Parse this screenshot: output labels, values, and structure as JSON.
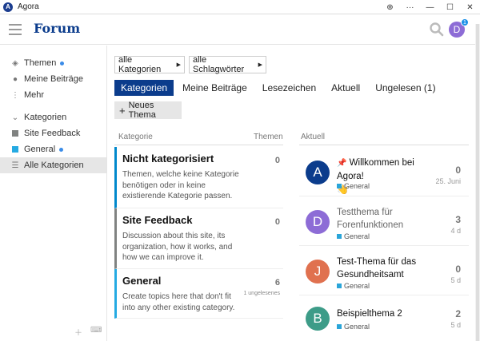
{
  "window": {
    "title": "Agora",
    "logo_letter": "A",
    "buttons": [
      "⊕",
      "···",
      "—",
      "☐",
      "✕"
    ]
  },
  "header": {
    "brand": "Forum",
    "user_initial": "D",
    "notification_count": "1",
    "avatar_color": "#8d6cd6"
  },
  "sidebar": {
    "items": [
      {
        "label": "Themen",
        "icon": "layers-icon",
        "dot": true
      },
      {
        "label": "Meine Beiträge",
        "icon": "user-icon",
        "dot": false
      },
      {
        "label": "Mehr",
        "icon": "more-icon",
        "dot": false
      },
      {
        "label": "Kategorien",
        "icon": "chevron-down-icon",
        "dot": false
      },
      {
        "label": "Site Feedback",
        "icon": "category-square",
        "color": "#808281",
        "dot": false
      },
      {
        "label": "General",
        "icon": "category-square",
        "color": "#25AAE2",
        "dot": true
      },
      {
        "label": "Alle Kategorien",
        "icon": "list-icon",
        "dot": false,
        "active": true
      }
    ]
  },
  "filters": {
    "category": "alle Kategorien",
    "tags": "alle Schlagwörter"
  },
  "tabs": [
    "Kategorien",
    "Meine Beiträge",
    "Lesezeichen",
    "Aktuell",
    "Ungelesen (1)"
  ],
  "active_tab": "Kategorien",
  "new_topic": "Neues Thema",
  "columns": {
    "category": "Kategorie",
    "topics": "Themen",
    "latest": "Aktuell"
  },
  "categories": [
    {
      "name": "Nicht kategorisiert",
      "description": "Themen, welche keine Kategorie benötigen oder in keine existierende Kategorie passen.",
      "count": "0",
      "color": "#0088CC",
      "sub": ""
    },
    {
      "name": "Site Feedback",
      "description": "Discussion about this site, its organization, how it works, and how we can improve it.",
      "count": "0",
      "color": "#808281",
      "sub": ""
    },
    {
      "name": "General",
      "description": "Create topics here that don't fit into any other existing category.",
      "count": "6",
      "color": "#25AAE2",
      "sub": "1 ungelesenes"
    }
  ],
  "topics": [
    {
      "initial": "A",
      "avatar_color": "#0b3c8c",
      "title": "Willkommen bei Agora!",
      "emoji": "👋",
      "pinned": true,
      "category": "General",
      "count": "0",
      "date": "25. Juni",
      "read": false
    },
    {
      "initial": "D",
      "avatar_color": "#8d6cd6",
      "title": "Testthema für Forenfunktionen",
      "emoji": "",
      "pinned": false,
      "category": "General",
      "count": "3",
      "date": "4 d",
      "read": true
    },
    {
      "initial": "J",
      "avatar_color": "#e0714f",
      "title": "Test-Thema für das Gesundheitsamt",
      "emoji": "",
      "pinned": false,
      "category": "General",
      "count": "0",
      "date": "5 d",
      "read": false
    },
    {
      "initial": "B",
      "avatar_color": "#3d9c88",
      "title": "Beispielthema 2",
      "emoji": "",
      "pinned": false,
      "category": "General",
      "count": "2",
      "date": "5 d",
      "read": false
    }
  ]
}
